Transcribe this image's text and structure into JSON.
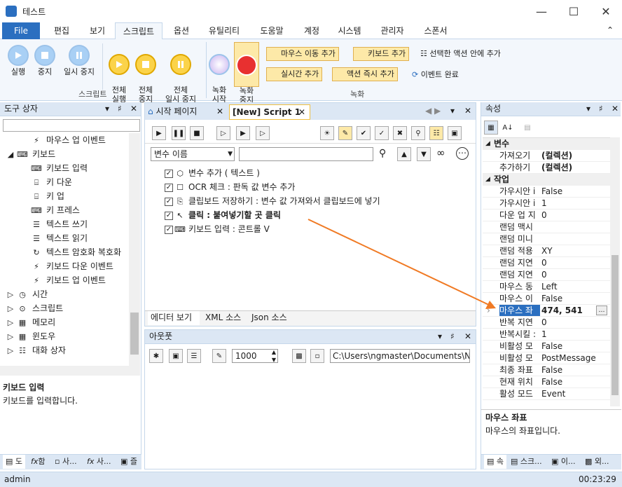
{
  "app": {
    "title": "테스트"
  },
  "menu": {
    "file": "File",
    "items": [
      "편집",
      "보기",
      "스크립트",
      "옵션",
      "유틸리티",
      "도움말",
      "계정",
      "시스템",
      "관리자",
      "스폰서"
    ]
  },
  "ribbon": {
    "script_group": {
      "label": "스크립트",
      "buttons": [
        "실행",
        "중지",
        "일시 중지",
        "전체\n실행",
        "전체\n중지",
        "전체\n일시 중지"
      ]
    },
    "record_group": {
      "label": "녹화",
      "buttons": [
        "녹화\n시작",
        "녹화\n중지"
      ],
      "small": [
        "마우스 이동 추가",
        "키보드 추가",
        "선택한 액션 안에 추가",
        "실시간 추가",
        "액션 즉시 추가",
        "이벤트 완료"
      ]
    }
  },
  "toolbox": {
    "title": "도구 상자",
    "items": [
      {
        "label": "마우스 업 이벤트",
        "icon": "lightning-icon",
        "indent": 2
      },
      {
        "label": "키보드",
        "icon": "keyboard-icon",
        "indent": 1,
        "expanded": true
      },
      {
        "label": "키보드 입력",
        "icon": "keyboard-icon",
        "indent": 2
      },
      {
        "label": "키 다운",
        "icon": "key-down-icon",
        "indent": 2
      },
      {
        "label": "키 업",
        "icon": "key-up-icon",
        "indent": 2
      },
      {
        "label": "키 프레스",
        "icon": "keyboard-icon",
        "indent": 2
      },
      {
        "label": "텍스트 쓰기",
        "icon": "book-icon",
        "indent": 2
      },
      {
        "label": "텍스트 읽기",
        "icon": "book-icon",
        "indent": 2
      },
      {
        "label": "텍스트 암호화 복호화",
        "icon": "cycle-icon",
        "indent": 2
      },
      {
        "label": "키보드 다운 이벤트",
        "icon": "lightning-icon",
        "indent": 2
      },
      {
        "label": "키보드 업 이벤트",
        "icon": "lightning-icon",
        "indent": 2
      },
      {
        "label": "시간",
        "icon": "clock-icon",
        "indent": 1
      },
      {
        "label": "스크립트",
        "icon": "script-icon",
        "indent": 1
      },
      {
        "label": "메모리",
        "icon": "memory-icon",
        "indent": 1
      },
      {
        "label": "윈도우",
        "icon": "window-icon",
        "indent": 1
      },
      {
        "label": "대화 상자",
        "icon": "dialog-icon",
        "indent": 1
      }
    ],
    "desc_title": "키보드 입력",
    "desc_text": "키보드를 입력합니다.",
    "bottom_tabs": [
      "도",
      "함",
      "사...",
      "사...",
      "즐"
    ]
  },
  "editor": {
    "tabs": [
      "시작 페이지",
      "[New] Script 1"
    ],
    "var_select": "변수 이름",
    "lines": [
      {
        "text": "변수 추가 ( 텍스트 )",
        "bold": false
      },
      {
        "text": "OCR 체크 : 판독 값 변수 추가",
        "bold": false
      },
      {
        "text": "클립보드 저장하기 : 변수 값 가져와서 클립보드에 넣기",
        "bold": false
      },
      {
        "text": "클릭 : 붙여넣기할 곳 클릭",
        "bold": true
      },
      {
        "text": "키보드 입력 : 콘트롤 V",
        "bold": false
      }
    ],
    "bottom_tabs": [
      "에디터 보기",
      "XML 소스",
      "Json 소스"
    ]
  },
  "output": {
    "title": "아웃풋",
    "count": "1000",
    "path": "C:\\Users\\ngmaster\\Documents\\NGM"
  },
  "properties": {
    "title": "속성",
    "sections": [
      {
        "name": "변수",
        "rows": [
          {
            "k": "가져오기",
            "v": "(컬렉션)",
            "bold": true
          },
          {
            "k": "추가하기",
            "v": "(컬렉션)",
            "bold": true
          }
        ]
      },
      {
        "name": "작업",
        "rows": [
          {
            "k": "가우시안 i",
            "v": "False"
          },
          {
            "k": "가우시안 i",
            "v": "1"
          },
          {
            "k": "다운 업 지",
            "v": "0"
          },
          {
            "k": "랜덤 맥시",
            "v": ""
          },
          {
            "k": "랜덤 미니",
            "v": ""
          },
          {
            "k": "랜덤 적용",
            "v": "XY"
          },
          {
            "k": "랜덤 지연",
            "v": "0"
          },
          {
            "k": "랜덤 지연",
            "v": "0"
          },
          {
            "k": "마우스 동",
            "v": "Left"
          },
          {
            "k": "마우스 이",
            "v": "False"
          },
          {
            "k": "마우스 좌",
            "v": "474, 541",
            "bold": true,
            "selected": true
          },
          {
            "k": "반복 지연",
            "v": "0"
          },
          {
            "k": "반복시킬 :",
            "v": "1"
          },
          {
            "k": "비활성 모",
            "v": "False"
          },
          {
            "k": "비활성 모",
            "v": "PostMessage"
          },
          {
            "k": "최종 좌표",
            "v": "False"
          },
          {
            "k": "현재 위치",
            "v": "False"
          },
          {
            "k": "활성 모드",
            "v": "Event"
          }
        ]
      }
    ],
    "desc_title": "마우스 좌표",
    "desc_text": "마우스의 좌표입니다.",
    "bottom_tabs": [
      "속",
      "스크...",
      "이...",
      "외..."
    ]
  },
  "status": {
    "user": "admin",
    "time": "00:23:29"
  },
  "colors": {
    "accent": "#2b6fc0",
    "panel": "#dce7f4",
    "highlight": "#fbd34a",
    "arrow": "#f07a24"
  }
}
